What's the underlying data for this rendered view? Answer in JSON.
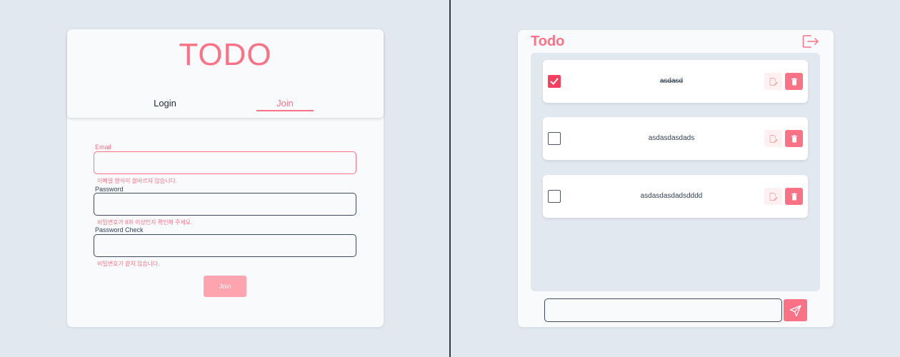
{
  "join_page": {
    "brand_title": "TODO",
    "tabs": [
      {
        "label": "Login",
        "active": false
      },
      {
        "label": "Join",
        "active": true
      }
    ],
    "fields": {
      "email": {
        "label": "Email",
        "value": "",
        "error": "이메일 형식이 올바르지 않습니다."
      },
      "password": {
        "label": "Password",
        "value": "",
        "error": "비밀번호가 8자 이상인지 확인해 주세요."
      },
      "password_check": {
        "label": "Password Check",
        "value": "",
        "error": "비밀번호가 같지 않습니다."
      }
    },
    "join_button_label": "Join"
  },
  "todo_page": {
    "title": "Todo",
    "logout_icon": "logout-icon",
    "items": [
      {
        "text": "asdasd",
        "completed": true
      },
      {
        "text": "asdasdasdads",
        "completed": false
      },
      {
        "text": "asdasdasdadsdddd",
        "completed": false
      }
    ],
    "new_todo": {
      "value": "",
      "placeholder": ""
    },
    "icons": {
      "edit": "edit-icon",
      "delete": "trash-icon",
      "send": "send-icon"
    }
  },
  "colors": {
    "accent": "#fb7185",
    "accent_light": "#fda4af",
    "accent_pale": "#fff1f2",
    "checked": "#f43f5e",
    "background": "#e2e8f0",
    "card": "#f8fafc",
    "border": "#3f4b5c"
  }
}
